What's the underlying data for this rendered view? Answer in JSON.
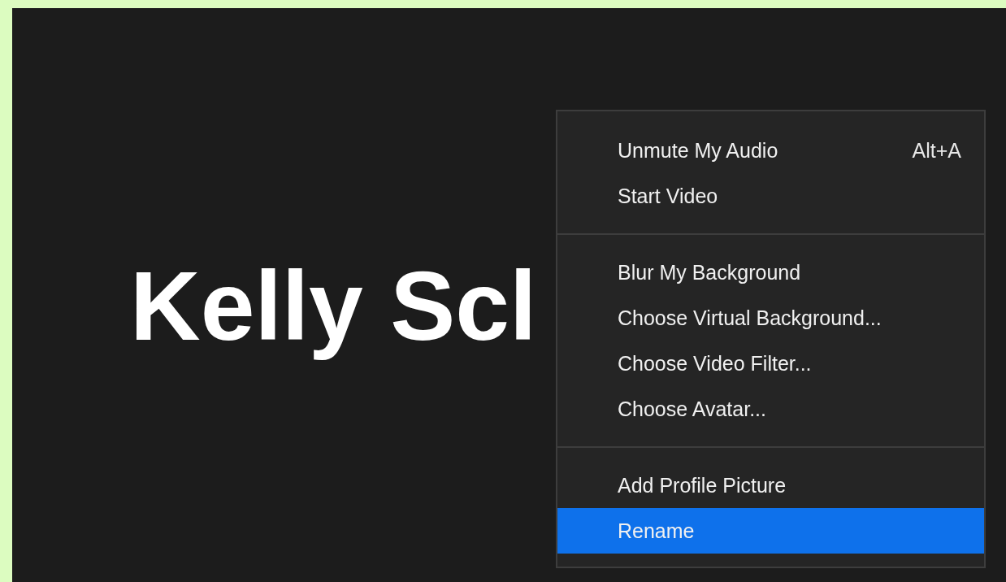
{
  "video_tile": {
    "name": "Kelly Scl"
  },
  "context_menu": {
    "groups": [
      {
        "items": [
          {
            "label": "Unmute My Audio",
            "shortcut": "Alt+A",
            "selected": false
          },
          {
            "label": "Start Video",
            "selected": false
          }
        ]
      },
      {
        "items": [
          {
            "label": "Blur My Background",
            "selected": false
          },
          {
            "label": "Choose Virtual Background...",
            "selected": false
          },
          {
            "label": "Choose Video Filter...",
            "selected": false
          },
          {
            "label": "Choose Avatar...",
            "selected": false
          }
        ]
      },
      {
        "items": [
          {
            "label": "Add Profile Picture",
            "selected": false
          },
          {
            "label": "Rename",
            "selected": true
          }
        ]
      }
    ]
  }
}
